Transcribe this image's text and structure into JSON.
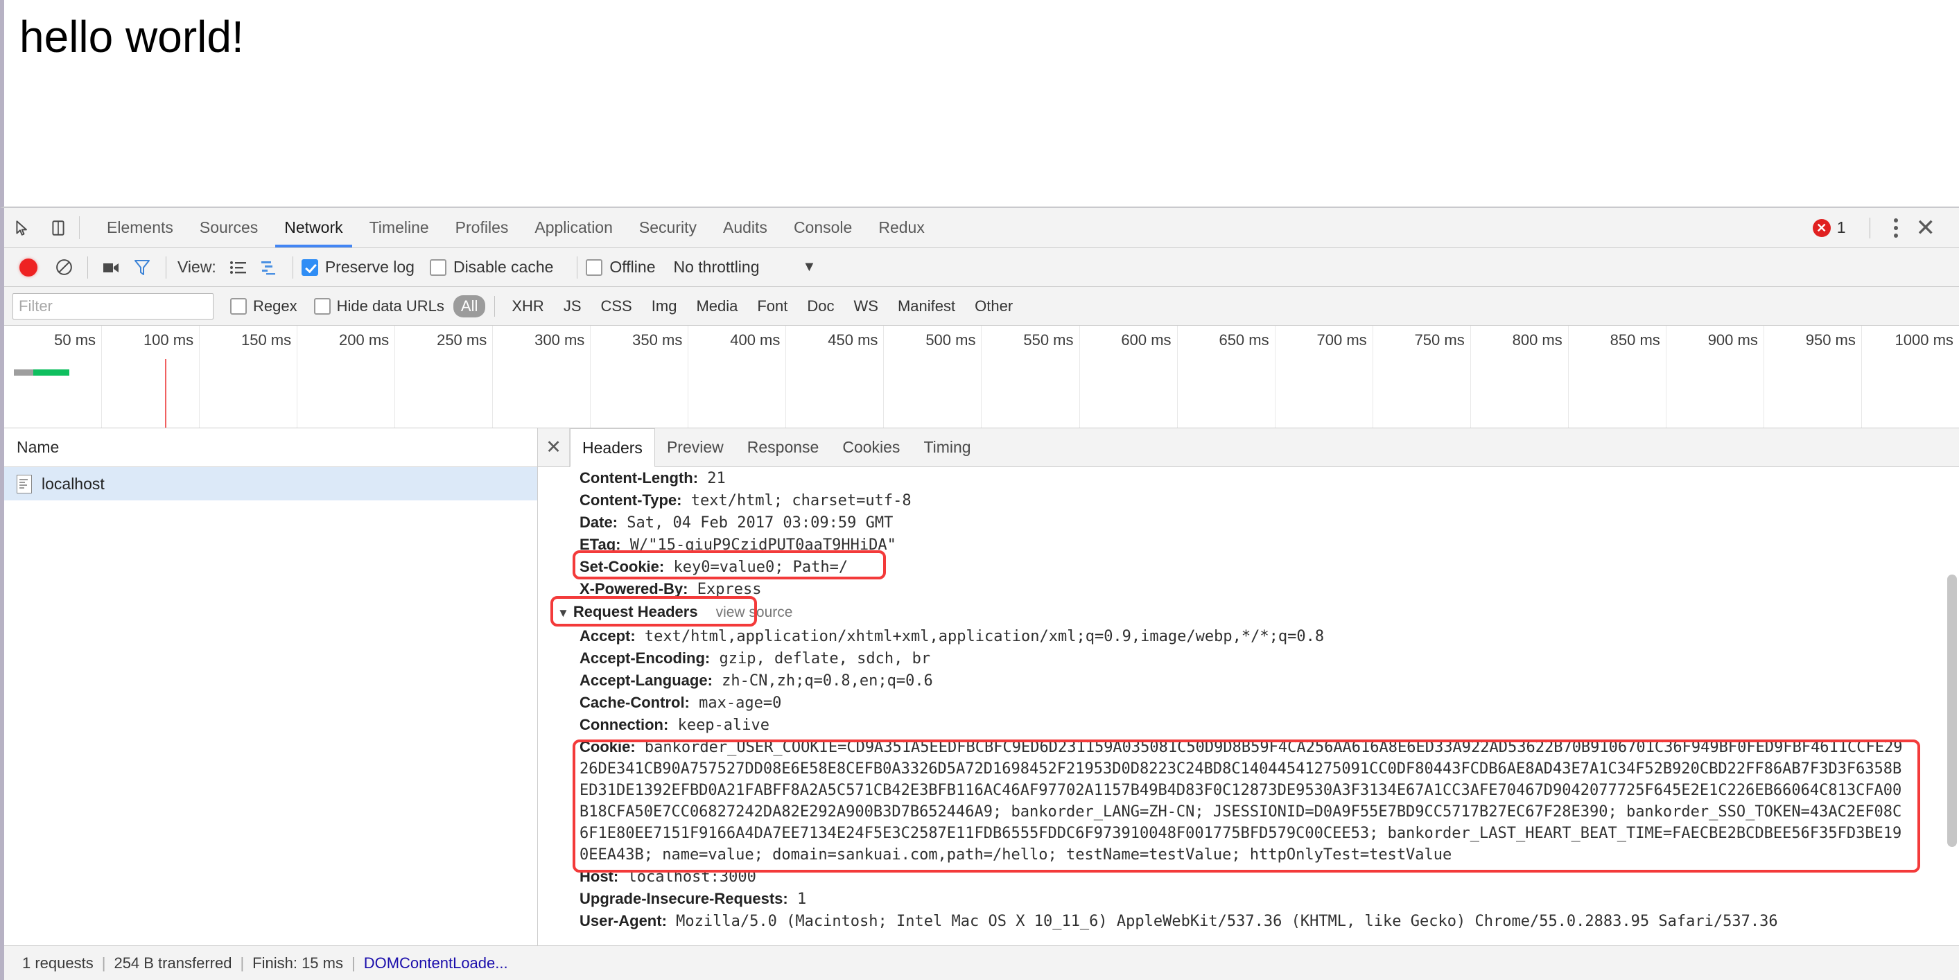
{
  "page": {
    "heading": "hello world!"
  },
  "devtools": {
    "inspect_icon": "cursor-select-icon",
    "device_icon": "device-toolbar-icon",
    "tabs": [
      {
        "label": "Elements",
        "active": false
      },
      {
        "label": "Sources",
        "active": false
      },
      {
        "label": "Network",
        "active": true
      },
      {
        "label": "Timeline",
        "active": false
      },
      {
        "label": "Profiles",
        "active": false
      },
      {
        "label": "Application",
        "active": false
      },
      {
        "label": "Security",
        "active": false
      },
      {
        "label": "Audits",
        "active": false
      },
      {
        "label": "Console",
        "active": false
      },
      {
        "label": "Redux",
        "active": false
      }
    ],
    "errors": {
      "count": "1",
      "icon": "error-circle-icon"
    },
    "more_icon": "kebab-menu-icon",
    "close_icon": "close-icon"
  },
  "network_toolbar": {
    "record_icon": "record-button",
    "clear_icon": "clear-icon",
    "capture_screenshots_icon": "camera-icon",
    "filter_icon": "funnel-icon",
    "view_label": "View:",
    "list_view_icon": "list-view-icon",
    "waterfall_view_icon": "waterfall-view-icon",
    "preserve_log": {
      "label": "Preserve log",
      "checked": true
    },
    "disable_cache": {
      "label": "Disable cache",
      "checked": false
    },
    "offline": {
      "label": "Offline",
      "checked": false
    },
    "throttling": {
      "value": "No throttling",
      "caret": "▼"
    }
  },
  "filter_bar": {
    "placeholder": "Filter",
    "value": "",
    "regex": {
      "label": "Regex",
      "checked": false
    },
    "hide_data_urls": {
      "label": "Hide data URLs",
      "checked": false
    },
    "types": [
      {
        "label": "All",
        "active": true
      },
      {
        "label": "XHR",
        "active": false
      },
      {
        "label": "JS",
        "active": false
      },
      {
        "label": "CSS",
        "active": false
      },
      {
        "label": "Img",
        "active": false
      },
      {
        "label": "Media",
        "active": false
      },
      {
        "label": "Font",
        "active": false
      },
      {
        "label": "Doc",
        "active": false
      },
      {
        "label": "WS",
        "active": false
      },
      {
        "label": "Manifest",
        "active": false
      },
      {
        "label": "Other",
        "active": false
      }
    ]
  },
  "overview": {
    "ticks": [
      "50 ms",
      "100 ms",
      "150 ms",
      "200 ms",
      "250 ms",
      "300 ms",
      "350 ms",
      "400 ms",
      "450 ms",
      "500 ms",
      "550 ms",
      "600 ms",
      "650 ms",
      "700 ms",
      "750 ms",
      "800 ms",
      "850 ms",
      "900 ms",
      "950 ms",
      "1000 ms"
    ],
    "dom_content_loaded_color": "#f06060",
    "load_bar_color": "#0fbf5f"
  },
  "request_list": {
    "column_header": "Name",
    "rows": [
      {
        "name": "localhost",
        "icon": "document-icon",
        "selected": true
      }
    ]
  },
  "detail": {
    "close_icon": "close-icon",
    "tabs": [
      {
        "label": "Headers",
        "active": true
      },
      {
        "label": "Preview",
        "active": false
      },
      {
        "label": "Response",
        "active": false
      },
      {
        "label": "Cookies",
        "active": false
      },
      {
        "label": "Timing",
        "active": false
      }
    ],
    "response_headers": [
      {
        "key": "Content-Length:",
        "value": " 21"
      },
      {
        "key": "Content-Type:",
        "value": " text/html; charset=utf-8"
      },
      {
        "key": "Date:",
        "value": " Sat, 04 Feb 2017 03:09:59 GMT"
      },
      {
        "key": "ETag:",
        "value": " W/\"15-qiuP9CzidPUT0aaT9HHiDA\""
      },
      {
        "key": "Set-Cookie:",
        "value": " key0=value0; Path=/",
        "highlighted": true
      },
      {
        "key": "X-Powered-By:",
        "value": " Express"
      }
    ],
    "request_headers_section": {
      "triangle": "▼",
      "title": "Request Headers",
      "view_source": "view source",
      "highlighted": true
    },
    "request_headers": [
      {
        "key": "Accept:",
        "value": " text/html,application/xhtml+xml,application/xml;q=0.9,image/webp,*/*;q=0.8"
      },
      {
        "key": "Accept-Encoding:",
        "value": " gzip, deflate, sdch, br"
      },
      {
        "key": "Accept-Language:",
        "value": " zh-CN,zh;q=0.8,en;q=0.6"
      },
      {
        "key": "Cache-Control:",
        "value": " max-age=0"
      },
      {
        "key": "Connection:",
        "value": " keep-alive"
      }
    ],
    "cookie_header": {
      "key": "Cookie:",
      "value": " bankorder_USER_COOKIE=CD9A351A5EEDFBCBFC9ED6D231159A035081C50D9D8B59F4CA256AA616A8E6ED33A922AD53622B70B9106701C36F949BF0FED9FBF4611CCFE2926DE341CB90A757527DD08E6E58E8CEFB0A3326D5A72D1698452F21953D0D8223C24BD8C14044541275091CC0DF80443FCDB6AE8AD43E7A1C34F52B920CBD22FF86AB7F3D3F6358BED31DE1392EFBD0A21FABFF8A2A5C571CB42E3BFB116AC46AF97702A1157B49B4D83F0C12873DE9530A3F3134E67A1CC3AFE70467D9042077725F645E2E1C226EB66064C813CFA00B18CFA50E7CC06827242DA82E292A900B3D7B652446A9; bankorder_LANG=ZH-CN; JSESSIONID=D0A9F55E7BD9CC5717B27EC67F28E390; bankorder_SSO_TOKEN=43AC2EF08C6F1E80EE7151F9166A4DA7EE7134E24F5E3C2587E11FDB6555FDDC6F973910048F001775BFD579C00CEE53; bankorder_LAST_HEART_BEAT_TIME=FAECBE2BCDBEE56F35FD3BE190EEA43B; name=value; domain=sankuai.com,path=/hello; testName=testValue; httpOnlyTest=testValue",
      "highlighted": true
    },
    "request_headers_tail": [
      {
        "key": "Host:",
        "value": " localhost:3000"
      },
      {
        "key": "Upgrade-Insecure-Requests:",
        "value": " 1"
      },
      {
        "key": "User-Agent:",
        "value": " Mozilla/5.0 (Macintosh; Intel Mac OS X 10_11_6) AppleWebKit/537.36 (KHTML, like Gecko) Chrome/55.0.2883.95 Safari/537.36"
      }
    ]
  },
  "status_bar": {
    "requests": "1 requests",
    "transferred": "254 B transferred",
    "finish": "Finish: 15 ms",
    "dom_content_loaded": "DOMContentLoade...",
    "divider": "|"
  }
}
